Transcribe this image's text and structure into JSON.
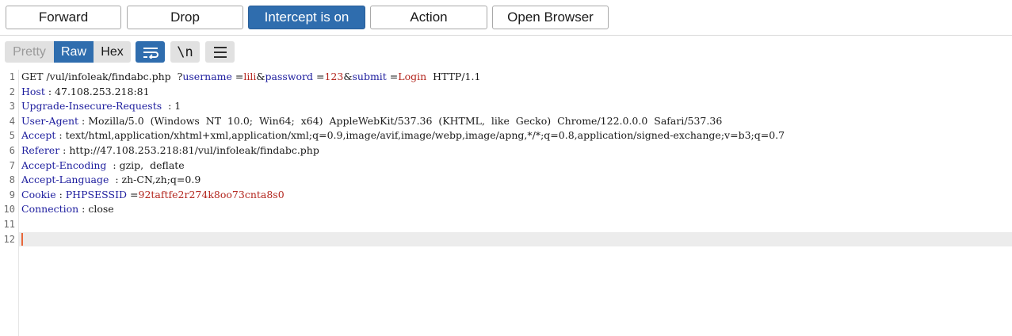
{
  "toolbar": {
    "forward": "Forward",
    "drop": "Drop",
    "intercept": "Intercept is on",
    "action": "Action",
    "open_browser": "Open Browser"
  },
  "view": {
    "pretty": "Pretty",
    "raw": "Raw",
    "hex": "Hex",
    "newline_toggle": "\\n",
    "wrap_icon": "word-wrap-icon",
    "menu_icon": "hamburger-menu-icon"
  },
  "editor": {
    "line_numbers": [
      "1",
      "2",
      "3",
      "4",
      "5",
      "6",
      "7",
      "8",
      "9",
      "10",
      "11",
      "12"
    ],
    "request_line": {
      "method": "GET",
      "path": "/vul/infoleak/findabc.php",
      "q": "?",
      "p1_name": "username",
      "p1_value": "lili",
      "p2_name": "password",
      "p2_value": "123",
      "p3_name": "submit",
      "p3_value": "Login",
      "protocol": "HTTP/1.1"
    },
    "headers": [
      {
        "name": "Host",
        "value": "47.108.253.218:81"
      },
      {
        "name": "Upgrade-Insecure-Requests",
        "value": "1"
      },
      {
        "name": "User-Agent",
        "value": "Mozilla/5.0  (Windows  NT  10.0;  Win64;  x64)  AppleWebKit/537.36  (KHTML,  like  Gecko)  Chrome/122.0.0.0  Safari/537.36"
      },
      {
        "name": "Accept",
        "value": "text/html,application/xhtml+xml,application/xml;q=0.9,image/avif,image/webp,image/apng,*/*;q=0.8,application/signed-exchange;v=b3;q=0.7"
      },
      {
        "name": "Referer",
        "value": "http://47.108.253.218:81/vul/infoleak/findabc.php"
      },
      {
        "name": "Accept-Encoding",
        "value": "gzip,  deflate"
      },
      {
        "name": "Accept-Language",
        "value": "zh-CN,zh;q=0.9"
      }
    ],
    "cookie": {
      "name": "Cookie",
      "cookie_name": "PHPSESSID",
      "cookie_value": "92taftfe2r274k8oo73cnta8s0"
    },
    "connection": {
      "name": "Connection",
      "value": "close"
    }
  },
  "colors": {
    "accent": "#2f6dae",
    "header_name": "#1d1d9e",
    "param_value": "#b3261e",
    "caret": "#e8663a"
  }
}
